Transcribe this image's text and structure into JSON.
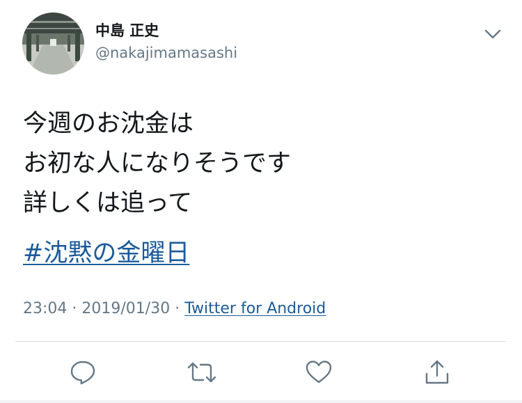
{
  "author": {
    "display_name": "中島 正史",
    "handle": "@nakajimamasashi",
    "avatar": "avatar-photo"
  },
  "tweet": {
    "lines": [
      "今週のお沈金は",
      "お初な人になりそうです",
      "詳しくは追って"
    ],
    "hashtag": "#沈黙の金曜日",
    "time": "23:04",
    "date": "2019/01/30",
    "separator": "·",
    "source": "Twitter for Android"
  },
  "icons": {
    "menu": "chevron-down-icon",
    "reply": "reply-icon",
    "retweet": "retweet-icon",
    "like": "heart-icon",
    "share": "share-icon"
  },
  "colors": {
    "text": "#14171a",
    "secondary": "#657786",
    "link": "#1b5a9a",
    "icon": "#657786",
    "divider": "#dadde1"
  }
}
